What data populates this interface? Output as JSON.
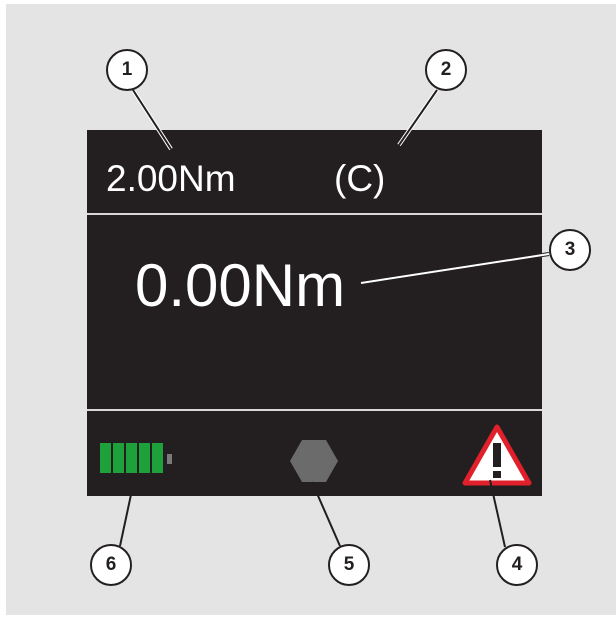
{
  "display": {
    "target_torque": "2.00Nm",
    "mode": "(C)",
    "actual_torque": "0.00Nm",
    "battery_segments": 5,
    "battery_color": "#1ea03a",
    "screw_icon": "hexagon-screw-icon",
    "screw_color": "#6b6b6b",
    "warning_icon": "warning-triangle-icon",
    "warning_color": "#e0202a"
  },
  "callouts": [
    {
      "number": "1"
    },
    {
      "number": "2"
    },
    {
      "number": "3"
    },
    {
      "number": "4"
    },
    {
      "number": "5"
    },
    {
      "number": "6"
    }
  ]
}
